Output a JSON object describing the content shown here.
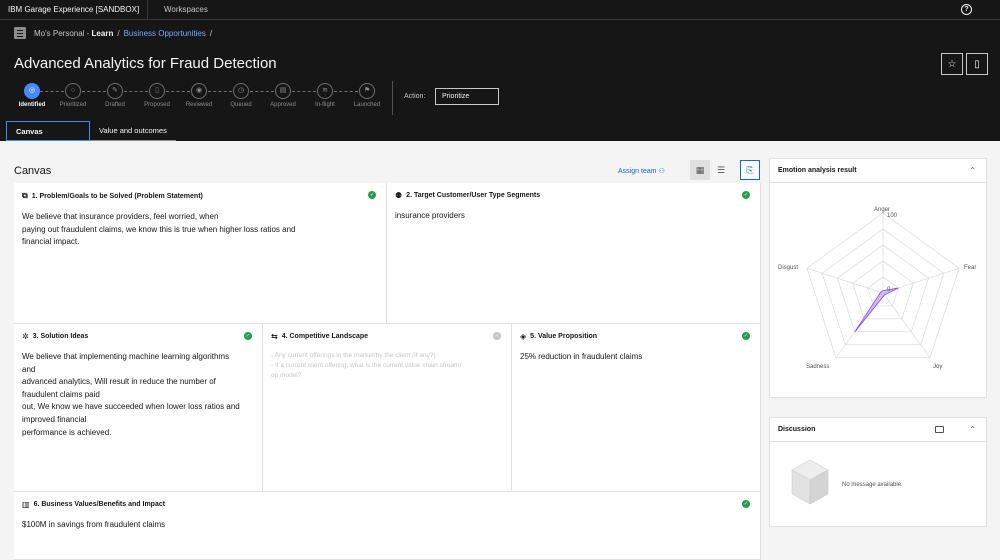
{
  "topbar": {
    "brand": "IBM Garage Experience [SANDBOX]",
    "workspaces": "Workspaces"
  },
  "header": {
    "breadcrumb": {
      "root": "Mo's Personal - ",
      "current": "Learn",
      "sep1": "/",
      "link": "Business Opportunities",
      "sep2": "/"
    },
    "title": "Advanced Analytics for Fraud Detection",
    "action_label": "Action:",
    "action_value": "Prioritize"
  },
  "steps": [
    "Identified",
    "Prioritized",
    "Drafted",
    "Proposed",
    "Reviewed",
    "Queued",
    "Approved",
    "In-flight",
    "Launched"
  ],
  "tabs": [
    "Canvas",
    "Value and outcomes"
  ],
  "canvas": {
    "title": "Canvas",
    "assign_team": "Assign team",
    "cards": [
      {
        "heading": "1. Problem/Goals to be Solved (Problem Statement)",
        "lines": [
          "We believe that insurance providers, feel worried, when",
          "paying out fraudulent claims, we know this is true when higher loss ratios and",
          "financial impact."
        ]
      },
      {
        "heading": "2. Target Customer/User Type Segments",
        "lines": [
          "insurance providers"
        ]
      },
      {
        "heading": "3. Solution Ideas",
        "lines": [
          "We believe that implementing machine learning algorithms",
          "and",
          "advanced analytics, Will result in reduce the number of",
          "fraudulent claims paid",
          "out, We know we have succeeded when lower loss ratios and",
          "improved financial",
          "performance is achieved."
        ]
      },
      {
        "heading": "4. Competitive Landscape",
        "lines": [
          "- Any current offerings in the market/by the client (if any?)",
          "- If a current client offering, what is the current value chain stream/",
          "op model?"
        ]
      },
      {
        "heading": "5. Value Proposition",
        "lines": [
          "25% reduction in fraudulent claims"
        ]
      },
      {
        "heading": "6. Business Values/Benefits and Impact",
        "lines": [
          "$100M in savings from fraudulent claims"
        ]
      }
    ]
  },
  "emotion": {
    "title": "Emotion analysis result",
    "labels": [
      "Anger",
      "Fear",
      "Joy",
      "Sadness",
      "Disgust"
    ],
    "scale_max": "100",
    "scale_min": "0",
    "values": [
      0,
      20,
      0,
      60,
      0
    ]
  },
  "discussion": {
    "title": "Discussion",
    "empty": "No message available."
  },
  "colors": {
    "accent": "#0f62fe",
    "success": "#24a148",
    "radar_fill": "#c9b5f5",
    "radar_stroke": "#8a3ffc"
  }
}
